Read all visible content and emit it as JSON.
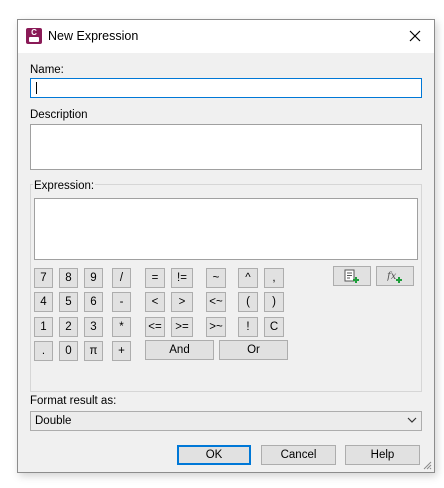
{
  "window": {
    "title": "New Expression",
    "icon": "expression-app-icon",
    "icon_letter": "C"
  },
  "fields": {
    "name_label": "Name:",
    "name_value": "",
    "description_label": "Description",
    "description_value": "",
    "expression_label": "Expression:",
    "expression_value": ""
  },
  "keypad": {
    "digits": [
      [
        "7",
        "8",
        "9",
        "/"
      ],
      [
        "4",
        "5",
        "6",
        "-"
      ],
      [
        "1",
        "2",
        "3",
        "*"
      ],
      [
        ".",
        "0",
        "π",
        "+"
      ]
    ],
    "compare": [
      [
        "=",
        "!="
      ],
      [
        "<",
        ">"
      ],
      [
        "<=",
        ">="
      ]
    ],
    "misc": [
      [
        "~",
        "^",
        ","
      ],
      [
        "<~",
        "(",
        ")"
      ],
      [
        ">~",
        "!",
        "C"
      ]
    ],
    "and_label": "And",
    "or_label": "Or",
    "insert_variable_icon": "insert-variable-icon",
    "insert_function_icon": "insert-function-icon"
  },
  "format": {
    "label": "Format result as:",
    "selected": "Double"
  },
  "buttons": {
    "ok": "OK",
    "cancel": "Cancel",
    "help": "Help"
  }
}
